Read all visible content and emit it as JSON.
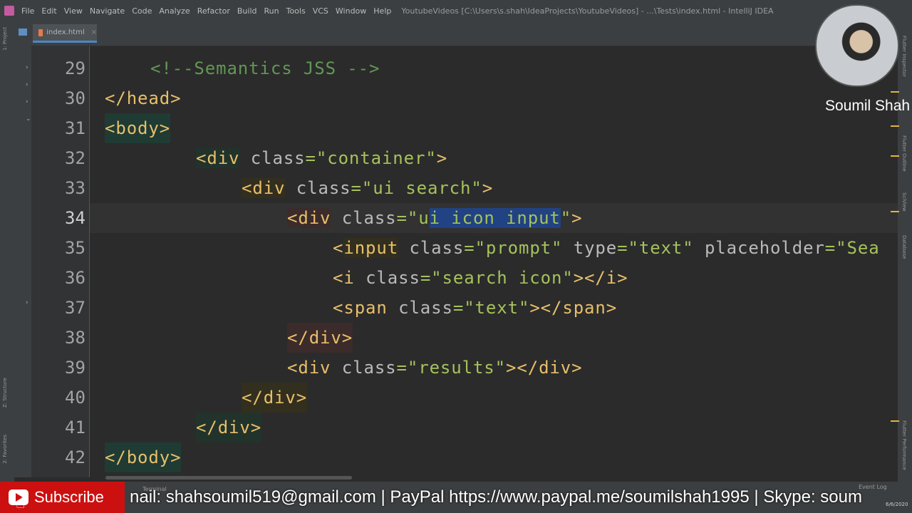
{
  "menubar": {
    "items": [
      "File",
      "Edit",
      "View",
      "Navigate",
      "Code",
      "Analyze",
      "Refactor",
      "Build",
      "Run",
      "Tools",
      "VCS",
      "Window",
      "Help"
    ],
    "title": "YoutubeVideos [C:\\Users\\s.shah\\IdeaProjects\\YoutubeVideos] - ...\\Tests\\index.html - IntelliJ IDEA"
  },
  "tabs": [
    {
      "label": "index.html"
    }
  ],
  "left_toolstrip": {
    "project": "1: Project",
    "structure": "Z: Structure",
    "favorites": "2: Favorites"
  },
  "right_toolstrip": {
    "flutter_inspector": "Flutter Inspector",
    "flutter_outline": "Flutter Outline",
    "sciview": "SciView",
    "database": "Database",
    "flutter_performance": "Flutter Performance"
  },
  "editor": {
    "lines": [
      {
        "num": "29",
        "text": "<!--Semantics JSS -->"
      },
      {
        "num": "30",
        "text": "</head>"
      },
      {
        "num": "31",
        "text": "<body>"
      },
      {
        "num": "32",
        "text": "<div class=\"container\">"
      },
      {
        "num": "33",
        "text": "<div class=\"ui search\">"
      },
      {
        "num": "34",
        "text": "<div class=\"ui icon input\">"
      },
      {
        "num": "35",
        "text": "<input class=\"prompt\" type=\"text\" placeholder=\"Sea"
      },
      {
        "num": "36",
        "text": "<i class=\"search icon\"></i>"
      },
      {
        "num": "37",
        "text": "<span class=\"text\"></span>"
      },
      {
        "num": "38",
        "text": "</div>"
      },
      {
        "num": "39",
        "text": "<div class=\"results\"></div>"
      },
      {
        "num": "40",
        "text": "</div>"
      },
      {
        "num": "41",
        "text": "</div>"
      },
      {
        "num": "42",
        "text": "</body>"
      }
    ]
  },
  "overlay": {
    "presenter_name": "Soumil Shah",
    "subscribe_label": "Subscribe",
    "ticker": "nail: shahsoumil519@gmail.com | PayPal https://www.paypal.me/soumilshah1995 | Skype: soum"
  },
  "statusbar": {
    "terminal": "Terminal",
    "event_log": "Event Log",
    "date": "6/6/2020"
  },
  "colors": {
    "background": "#2b2b2b",
    "tag": "#e8bf6a",
    "attribute": "#bababa",
    "value": "#a5c25c",
    "comment": "#629755",
    "selection": "#214283"
  }
}
